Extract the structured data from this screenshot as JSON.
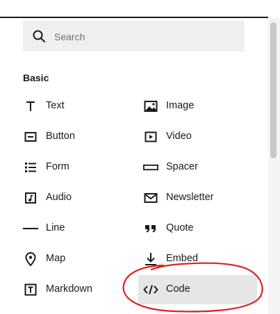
{
  "search": {
    "placeholder": "Search",
    "icon": "search-icon"
  },
  "section": {
    "title": "Basic"
  },
  "blocks_left": [
    {
      "label": "Text",
      "icon": "text-icon"
    },
    {
      "label": "Button",
      "icon": "button-icon"
    },
    {
      "label": "Form",
      "icon": "form-icon"
    },
    {
      "label": "Audio",
      "icon": "audio-icon"
    },
    {
      "label": "Line",
      "icon": "line-icon"
    },
    {
      "label": "Map",
      "icon": "map-pin-icon"
    },
    {
      "label": "Markdown",
      "icon": "markdown-icon"
    }
  ],
  "blocks_right": [
    {
      "label": "Image",
      "icon": "image-icon"
    },
    {
      "label": "Video",
      "icon": "video-icon"
    },
    {
      "label": "Spacer",
      "icon": "spacer-icon"
    },
    {
      "label": "Newsletter",
      "icon": "envelope-icon"
    },
    {
      "label": "Quote",
      "icon": "quote-icon"
    },
    {
      "label": "Embed",
      "icon": "embed-icon"
    },
    {
      "label": "Code",
      "icon": "code-icon",
      "selected": true
    }
  ],
  "colors": {
    "annotation": "#e0201c",
    "selected_bg": "#e6e6e6",
    "search_bg": "#efefef"
  }
}
